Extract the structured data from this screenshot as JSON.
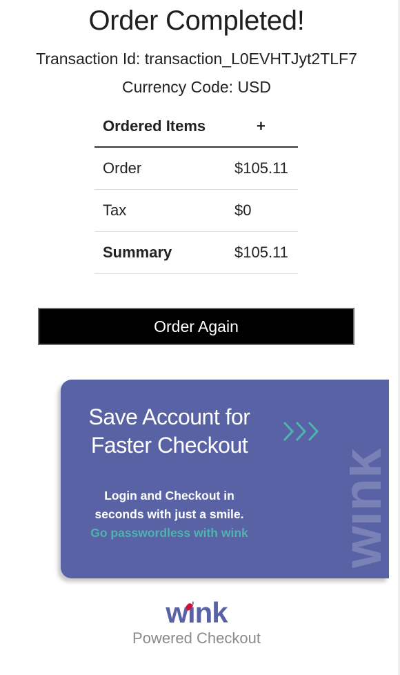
{
  "header": {
    "title": "Order Completed!",
    "transaction_line": "Transaction Id: transaction_L0EVHTJyt2TLF7",
    "currency_line": "Currency Code: USD"
  },
  "items_table": {
    "header_label": "Ordered Items",
    "expand_symbol": "+",
    "rows": [
      {
        "label": "Order",
        "value": "$105.11"
      },
      {
        "label": "Tax",
        "value": "$0"
      },
      {
        "label": "Summary",
        "value": "$105.11"
      }
    ]
  },
  "actions": {
    "order_again_label": "Order Again"
  },
  "promo": {
    "title_line1": "Save Account for",
    "title_line2": "Faster Checkout",
    "body_line1": "Login and Checkout in",
    "body_line2": "seconds with just a smile.",
    "link_text": "Go passwordless with wink",
    "watermark_text": "wink",
    "card_color": "#5962a4",
    "accent_color": "#4fb3ae"
  },
  "footer": {
    "logo_text": "wink",
    "caption": "Powered Checkout",
    "logo_color": "#5962a4",
    "logo_dot_color": "#d0103a"
  },
  "icons": {
    "expand": "plus-icon",
    "arrows": "chevrons-right-icon"
  }
}
